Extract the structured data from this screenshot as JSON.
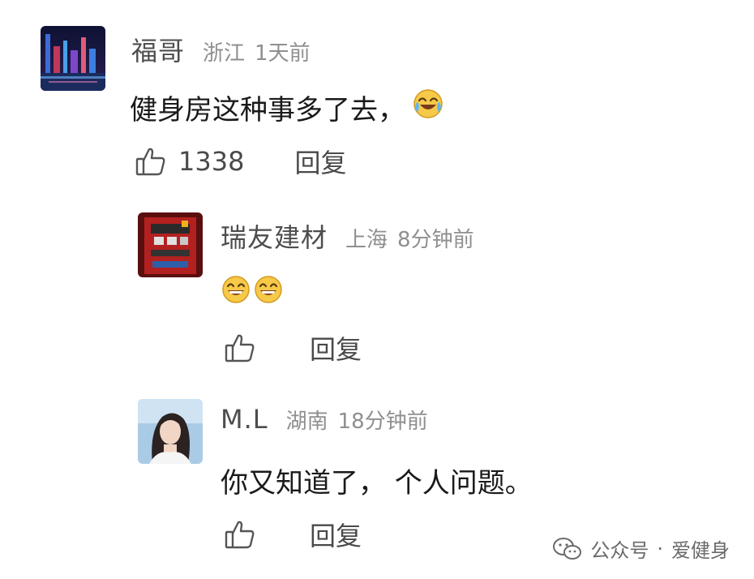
{
  "comments": [
    {
      "username": "福哥",
      "location": "浙江",
      "time": "1天前",
      "text": "健身房这种事多了去，",
      "emoji": "laugh-cry",
      "likes": "1338",
      "reply_label": "回复"
    },
    {
      "username": "瑞友建材",
      "location": "上海",
      "time": "8分钟前",
      "emoji": "grin-grin",
      "reply_label": "回复"
    },
    {
      "username": "M.L",
      "location": "湖南",
      "time": "18分钟前",
      "text": "你又知道了， 个人问题。",
      "reply_label": "回复"
    }
  ],
  "watermark": {
    "channel": "公众号",
    "dot": "·",
    "name": "爱健身"
  },
  "icons": {
    "like": "thumbs-up-icon",
    "wechat": "wechat-icon"
  },
  "colors": {
    "username": "#4d4d4d",
    "meta": "#8f8f8f",
    "text": "#1a1a1a"
  }
}
